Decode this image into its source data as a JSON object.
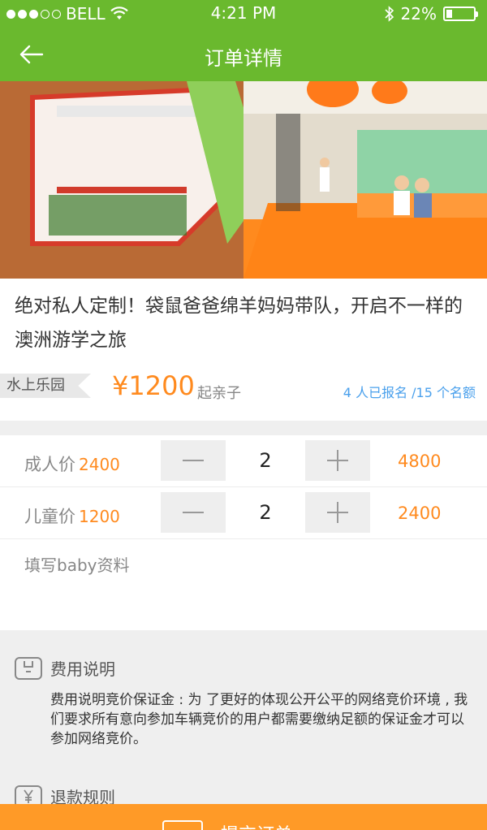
{
  "status_bar": {
    "carrier": "BELL",
    "time": "4:21 PM",
    "battery_percent": "22%",
    "battery_level": 0.22
  },
  "nav": {
    "title": "订单详情",
    "back_icon": "back-arrow-icon"
  },
  "product": {
    "title": "绝对私人定制！袋鼠爸爸绵羊妈妈带队，开启不一样的澳洲游学之旅",
    "tag": "水上乐园",
    "price": "¥1200",
    "price_suffix": "起亲子",
    "enrollment": "4 人已报名 /15 个名额"
  },
  "pricing": {
    "adult": {
      "label": "成人价",
      "unit_price": "2400",
      "quantity": "2",
      "total": "4800"
    },
    "child": {
      "label": "儿童价",
      "unit_price": "1200",
      "quantity": "2",
      "total": "2400"
    },
    "baby_info_link": "填写baby资料"
  },
  "fee": {
    "heading": "费用说明",
    "text": "费用说明竞价保证金 : 为  了更好的体现公开公平的网络竞价环境 , 我们要求所有意向参加车辆竞价的用户都需要缴纳足额的保证金才可以参加网络竞价。"
  },
  "refund": {
    "heading": "退款规则"
  },
  "submit": {
    "label": "提交订单"
  },
  "colors": {
    "brand_green": "#6ab92e",
    "accent_orange": "#ff8a1e",
    "link_blue": "#4aa0ec"
  }
}
